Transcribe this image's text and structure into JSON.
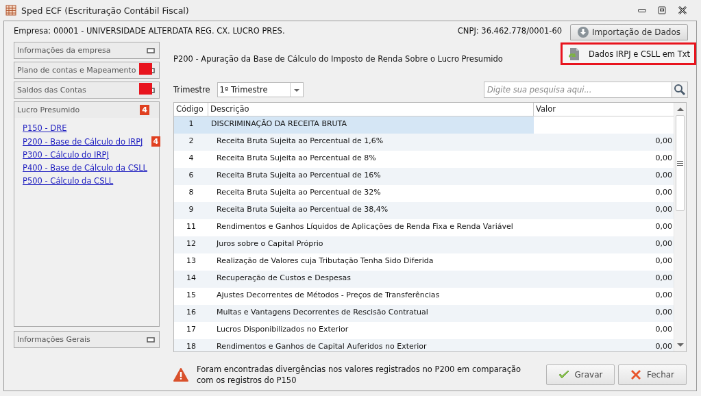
{
  "window": {
    "title": "Sped ECF (Escrituração Contábil Fiscal)"
  },
  "company": {
    "label": "Empresa: 00001 - UNIVERSIDADE ALTERDATA REG. CX. LUCRO PRES.",
    "cnpj": "CNPJ: 36.462.778/0001-60"
  },
  "import_button": {
    "label": "Importação de Dados",
    "menu": [
      {
        "label": "Dados IRPJ e CSLL em Txt",
        "highlighted": true
      }
    ]
  },
  "sidebar": {
    "sections": [
      {
        "title": "Informações da empresa",
        "expanded": false,
        "marked": false
      },
      {
        "title": "Plano de contas e Mapeamento",
        "expanded": false,
        "marked": true
      },
      {
        "title": "Saldos das Contas",
        "expanded": false,
        "marked": true
      },
      {
        "title": "Lucro Presumido",
        "expanded": true,
        "marked": false,
        "badge": "4",
        "items": [
          {
            "label": "P150 - DRE"
          },
          {
            "label": "P200 - Base de Cálculo do IRPJ",
            "badge": "4"
          },
          {
            "label": "P300 - Cálculo do IRPJ"
          },
          {
            "label": "P400 - Base de Cálculo da CSLL"
          },
          {
            "label": "P500 - Cálculo da CSLL"
          }
        ]
      }
    ],
    "footer_section": {
      "title": "Informações Gerais",
      "expanded": false
    }
  },
  "heading": "P200 - Apuração da Base de Cálculo do Imposto de Renda Sobre o Lucro Presumido",
  "quarter": {
    "label": "Trimestre",
    "value": "1º Trimestre"
  },
  "search": {
    "placeholder": "Digite sua pesquisa aqui..."
  },
  "table": {
    "columns": [
      "Código",
      "Descrição",
      "Valor"
    ],
    "rows": [
      {
        "code": "1",
        "description": "DISCRIMINAÇÃO DA RECEITA BRUTA",
        "kind": "group",
        "selected": true
      },
      {
        "code": "2",
        "description": "Receita Bruta Sujeita ao Percentual de 1,6%",
        "value": "0,00",
        "kind": "item",
        "selected": false
      },
      {
        "code": "4",
        "description": "Receita Bruta Sujeita ao Percentual de 8%",
        "value": "0,00",
        "kind": "item",
        "selected": false
      },
      {
        "code": "6",
        "description": "Receita Bruta Sujeita ao Percentual de 16%",
        "value": "0,00",
        "kind": "item",
        "selected": false
      },
      {
        "code": "8",
        "description": "Receita Bruta Sujeita ao Percentual de 32%",
        "value": "0,00",
        "kind": "item",
        "selected": false
      },
      {
        "code": "9",
        "description": "Receita Bruta Sujeita ao Percentual de 38,4%",
        "value": "0,00",
        "kind": "item",
        "selected": false
      },
      {
        "code": "11",
        "description": "Rendimentos e Ganhos Líquidos de Aplicações de Renda Fixa e Renda Variável",
        "value": "0,00",
        "kind": "item",
        "selected": false
      },
      {
        "code": "12",
        "description": "Juros sobre o Capital Próprio",
        "value": "0,00",
        "kind": "item",
        "selected": false
      },
      {
        "code": "13",
        "description": "Realização de Valores cuja Tributação Tenha Sido Diferida",
        "value": "0,00",
        "kind": "item",
        "selected": false
      },
      {
        "code": "14",
        "description": "Recuperação de Custos e Despesas",
        "value": "0,00",
        "kind": "item",
        "selected": false
      },
      {
        "code": "15",
        "description": "Ajustes Decorrentes de Métodos - Preços de Transferências",
        "value": "0,00",
        "kind": "item",
        "selected": false
      },
      {
        "code": "16",
        "description": "Multas e Vantagens Decorrentes de Rescisão Contratual",
        "value": "0,00",
        "kind": "item",
        "selected": false
      },
      {
        "code": "17",
        "description": "Lucros Disponibilizados no Exterior",
        "value": "0,00",
        "kind": "item",
        "selected": false
      },
      {
        "code": "18",
        "description": "Rendimentos e Ganhos de Capital Auferidos no Exterior",
        "value": "0,00",
        "kind": "item",
        "selected": false
      }
    ]
  },
  "warning": "Foram encontradas divergências nos valores registrados no P200 em comparação com os registros do P150",
  "buttons": [
    {
      "label": "Gravar",
      "kind": "save"
    },
    {
      "label": "Fechar",
      "kind": "close"
    }
  ]
}
